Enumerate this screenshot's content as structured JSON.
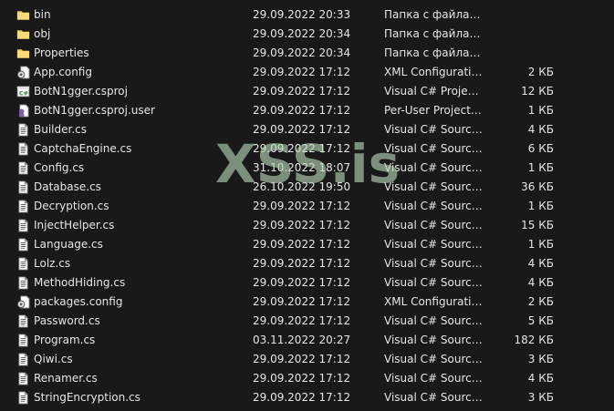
{
  "files": [
    {
      "name": "bin",
      "date": "29.09.2022 20:33",
      "type": "Папка с файлами",
      "size": "",
      "icon": "folder-icon"
    },
    {
      "name": "obj",
      "date": "29.09.2022 20:34",
      "type": "Папка с файлами",
      "size": "",
      "icon": "folder-icon"
    },
    {
      "name": "Properties",
      "date": "29.09.2022 20:34",
      "type": "Папка с файлами",
      "size": "",
      "icon": "folder-icon"
    },
    {
      "name": "App.config",
      "date": "29.09.2022 17:12",
      "type": "XML Configuratio...",
      "size": "2 КБ",
      "icon": "config-file-icon"
    },
    {
      "name": "BotN1gger.csproj",
      "date": "29.09.2022 17:12",
      "type": "Visual C# Project ...",
      "size": "12 КБ",
      "icon": "csproj-file-icon"
    },
    {
      "name": "BotN1gger.csproj.user",
      "date": "29.09.2022 17:12",
      "type": "Per-User Project O...",
      "size": "1 КБ",
      "icon": "user-project-file-icon"
    },
    {
      "name": "Builder.cs",
      "date": "29.09.2022 17:12",
      "type": "Visual C# Source F...",
      "size": "4 КБ",
      "icon": "cs-file-icon"
    },
    {
      "name": "CaptchaEngine.cs",
      "date": "29.09.2022 17:12",
      "type": "Visual C# Source F...",
      "size": "6 КБ",
      "icon": "cs-file-icon"
    },
    {
      "name": "Config.cs",
      "date": "31.10.2022 18:07",
      "type": "Visual C# Source F...",
      "size": "1 КБ",
      "icon": "cs-file-icon"
    },
    {
      "name": "Database.cs",
      "date": "26.10.2022 19:50",
      "type": "Visual C# Source F...",
      "size": "36 КБ",
      "icon": "cs-file-icon"
    },
    {
      "name": "Decryption.cs",
      "date": "29.09.2022 17:12",
      "type": "Visual C# Source F...",
      "size": "1 КБ",
      "icon": "cs-file-icon"
    },
    {
      "name": "InjectHelper.cs",
      "date": "29.09.2022 17:12",
      "type": "Visual C# Source F...",
      "size": "15 КБ",
      "icon": "cs-file-icon"
    },
    {
      "name": "Language.cs",
      "date": "29.09.2022 17:12",
      "type": "Visual C# Source F...",
      "size": "1 КБ",
      "icon": "cs-file-icon"
    },
    {
      "name": "Lolz.cs",
      "date": "29.09.2022 17:12",
      "type": "Visual C# Source F...",
      "size": "4 КБ",
      "icon": "cs-file-icon"
    },
    {
      "name": "MethodHiding.cs",
      "date": "29.09.2022 17:12",
      "type": "Visual C# Source F...",
      "size": "4 КБ",
      "icon": "cs-file-icon"
    },
    {
      "name": "packages.config",
      "date": "29.09.2022 17:12",
      "type": "XML Configuratio...",
      "size": "2 КБ",
      "icon": "config-file-icon"
    },
    {
      "name": "Password.cs",
      "date": "29.09.2022 17:12",
      "type": "Visual C# Source F...",
      "size": "5 КБ",
      "icon": "cs-file-icon"
    },
    {
      "name": "Program.cs",
      "date": "03.11.2022 20:27",
      "type": "Visual C# Source F...",
      "size": "182 КБ",
      "icon": "cs-file-icon"
    },
    {
      "name": "Qiwi.cs",
      "date": "29.09.2022 17:12",
      "type": "Visual C# Source F...",
      "size": "3 КБ",
      "icon": "cs-file-icon"
    },
    {
      "name": "Renamer.cs",
      "date": "29.09.2022 17:12",
      "type": "Visual C# Source F...",
      "size": "4 КБ",
      "icon": "cs-file-icon"
    },
    {
      "name": "StringEncryption.cs",
      "date": "29.09.2022 17:12",
      "type": "Visual C# Source F...",
      "size": "3 КБ",
      "icon": "cs-file-icon"
    }
  ],
  "watermark": "XSS.is",
  "colors": {
    "background": "#191919",
    "text": "#e6e6e6",
    "folder": "#f2c94c",
    "watermark": "#b9d7b9"
  }
}
